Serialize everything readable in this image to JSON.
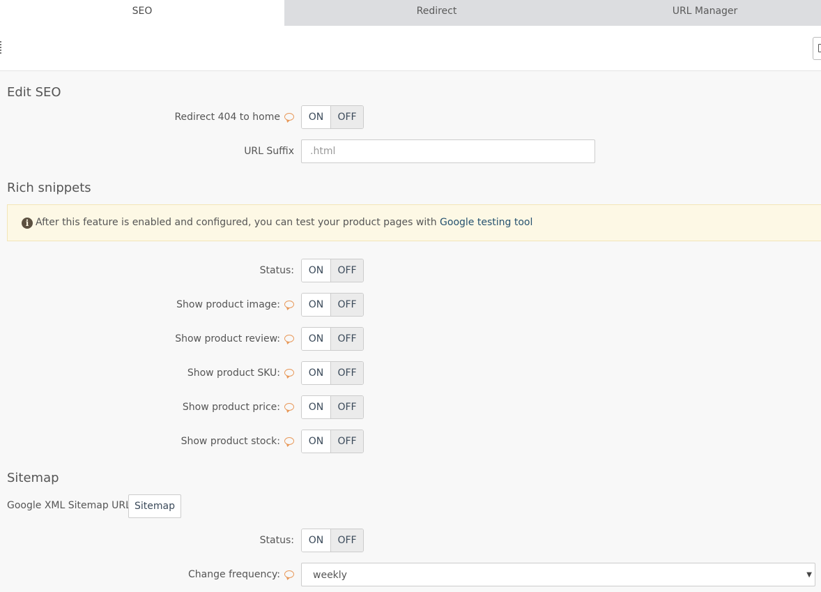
{
  "tabs": [
    {
      "label": "SEO",
      "active": true
    },
    {
      "label": "Redirect",
      "active": false
    },
    {
      "label": "URL Manager",
      "active": false
    }
  ],
  "sections": {
    "edit_seo": {
      "title": "Edit SEO",
      "redirect_404": {
        "label": "Redirect 404 to home",
        "on": "ON",
        "off": "OFF",
        "selected": "OFF"
      },
      "url_suffix": {
        "label": "URL Suffix",
        "placeholder": ".html",
        "value": ""
      }
    },
    "rich_snippets": {
      "title": "Rich snippets",
      "alert": {
        "icon": "info-circle-icon",
        "text": "After this feature is enabled and configured, you can test your product pages with ",
        "link": "Google testing tool"
      },
      "rows": [
        {
          "label": "Status:",
          "help": false,
          "on": "ON",
          "off": "OFF",
          "selected": "OFF"
        },
        {
          "label": "Show product image:",
          "help": true,
          "on": "ON",
          "off": "OFF",
          "selected": "OFF"
        },
        {
          "label": "Show product review:",
          "help": true,
          "on": "ON",
          "off": "OFF",
          "selected": "OFF"
        },
        {
          "label": "Show product SKU:",
          "help": true,
          "on": "ON",
          "off": "OFF",
          "selected": "OFF"
        },
        {
          "label": "Show product price:",
          "help": true,
          "on": "ON",
          "off": "OFF",
          "selected": "OFF"
        },
        {
          "label": "Show product stock:",
          "help": true,
          "on": "ON",
          "off": "OFF",
          "selected": "OFF"
        }
      ]
    },
    "sitemap": {
      "title": "Sitemap",
      "url_label": "Google XML Sitemap URL",
      "url_button": "Sitemap",
      "status": {
        "label": "Status:",
        "on": "ON",
        "off": "OFF",
        "selected": "OFF"
      },
      "frequency": {
        "label": "Change frequency:",
        "value": "weekly"
      }
    }
  },
  "colors": {
    "accent_help": "#e8995a",
    "link": "#25516f",
    "alert_bg": "#fdf8e5"
  }
}
